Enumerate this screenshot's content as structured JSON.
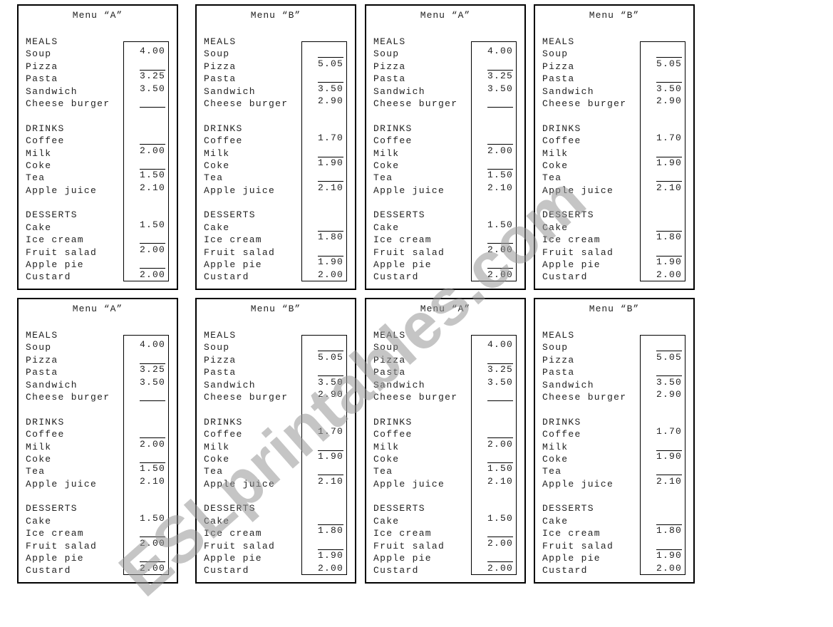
{
  "menus": {
    "A": {
      "title": "Menu “A”",
      "sections": [
        {
          "heading": "MEALS",
          "items": [
            {
              "name": "Soup",
              "price": "4.00"
            },
            {
              "name": "Pizza",
              "price": ""
            },
            {
              "name": "Pasta",
              "price": "3.25"
            },
            {
              "name": "Sandwich",
              "price": "3.50"
            },
            {
              "name": "Cheese burger",
              "price": ""
            }
          ]
        },
        {
          "heading": "DRINKS",
          "items": [
            {
              "name": "Coffee",
              "price": ""
            },
            {
              "name": "Milk",
              "price": "2.00"
            },
            {
              "name": "Coke",
              "price": ""
            },
            {
              "name": "Tea",
              "price": "1.50"
            },
            {
              "name": "Apple juice",
              "price": "2.10"
            }
          ]
        },
        {
          "heading": "DESSERTS",
          "items": [
            {
              "name": "Cake",
              "price": "1.50"
            },
            {
              "name": "Ice cream",
              "price": ""
            },
            {
              "name": "Fruit salad",
              "price": "2.00"
            },
            {
              "name": "Apple pie",
              "price": ""
            },
            {
              "name": "Custard",
              "price": "2.00"
            }
          ]
        }
      ]
    },
    "B": {
      "title": "Menu “B”",
      "sections": [
        {
          "heading": "MEALS",
          "items": [
            {
              "name": "Soup",
              "price": ""
            },
            {
              "name": "Pizza",
              "price": "5.05"
            },
            {
              "name": "Pasta",
              "price": ""
            },
            {
              "name": "Sandwich",
              "price": "3.50"
            },
            {
              "name": "Cheese burger",
              "price": "2.90"
            }
          ]
        },
        {
          "heading": "DRINKS",
          "items": [
            {
              "name": "Coffee",
              "price": "1.70"
            },
            {
              "name": "Milk",
              "price": ""
            },
            {
              "name": "Coke",
              "price": "1.90"
            },
            {
              "name": "Tea",
              "price": ""
            },
            {
              "name": "Apple juice",
              "price": "2.10"
            }
          ]
        },
        {
          "heading": "DESSERTS",
          "items": [
            {
              "name": "Cake",
              "price": ""
            },
            {
              "name": "Ice cream",
              "price": "1.80"
            },
            {
              "name": "Fruit salad",
              "price": ""
            },
            {
              "name": "Apple pie",
              "price": "1.90"
            },
            {
              "name": "Custard",
              "price": "2.00"
            }
          ]
        }
      ]
    }
  },
  "cards": [
    "A",
    "B",
    "A",
    "B",
    "A",
    "B",
    "A",
    "B"
  ],
  "watermark": "ESLprintables.com"
}
